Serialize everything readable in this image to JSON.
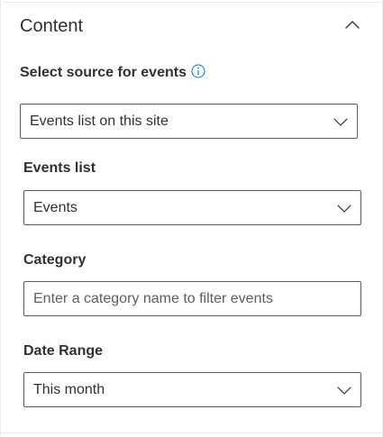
{
  "section": {
    "title": "Content"
  },
  "source": {
    "label": "Select source for events",
    "selected": "Events list on this site"
  },
  "events_list": {
    "label": "Events list",
    "selected": "Events"
  },
  "category": {
    "label": "Category",
    "placeholder": "Enter a category name to filter events",
    "value": ""
  },
  "date_range": {
    "label": "Date Range",
    "selected": "This month"
  },
  "colors": {
    "text": "#323130",
    "border": "#605e5c",
    "accent": "#0078d4",
    "divider": "#edebe9"
  },
  "icons": {
    "collapse": "chevron-up-icon",
    "info": "info-icon",
    "dropdown": "chevron-down-icon"
  }
}
